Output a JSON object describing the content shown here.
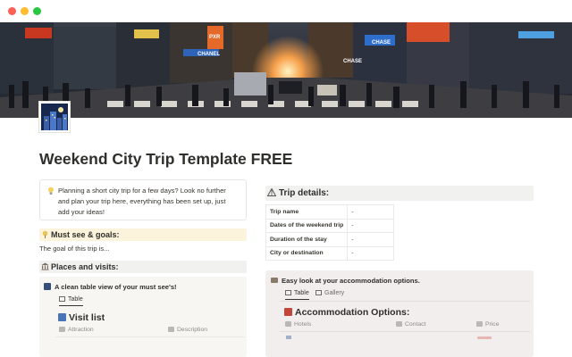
{
  "window": {
    "controls": [
      "close",
      "minimize",
      "zoom"
    ]
  },
  "cover": {
    "image": "city-street-crosswalk-photo",
    "signs": [
      "CHASE",
      "CHASE",
      "CHANEL",
      "PXR"
    ]
  },
  "page": {
    "icon": "city-night-icon",
    "title": "Weekend City Trip Template FREE"
  },
  "callout": {
    "icon": "lightbulb-icon",
    "text": "Planning a short city trip for a few days? Look no further and plan your trip here, everything has been set up, just add your ideas!"
  },
  "must_see": {
    "icon": "pushpin-icon",
    "heading": "Must see & goals:",
    "goal_text": "The goal of this trip is..."
  },
  "places": {
    "icon": "classical-building-icon",
    "heading": "Places and visits:",
    "caption": "A clean table view of your must see's!",
    "caption_icon": "night-city-icon",
    "view_tab": "Table",
    "db_icon": "cityscape-icon",
    "db_title": "Visit list",
    "columns": [
      "Attraction",
      "Description"
    ]
  },
  "trip_details": {
    "icon": "camping-icon",
    "heading": "Trip details:",
    "rows": [
      {
        "label": "Trip name",
        "value": "-"
      },
      {
        "label": "Dates of the weekend trip",
        "value": "-"
      },
      {
        "label": "Duration of the stay",
        "value": "-"
      },
      {
        "label": "City or destination",
        "value": "-"
      }
    ]
  },
  "accommodation": {
    "caption_icon": "bed-icon",
    "caption": "Easy look at your accommodation options.",
    "tabs": [
      {
        "label": "Table",
        "active": true
      },
      {
        "label": "Gallery",
        "active": false
      }
    ],
    "db_icon": "hotel-icon",
    "db_title": "Accommodation Options:",
    "columns": [
      "Hotels",
      "Contact",
      "Price"
    ]
  },
  "colors": {
    "must_see_bg": "#fbf3db",
    "section_bg": "#f1f1ef",
    "places_box_bg": "#f7f6f3",
    "accommodation_bg": "#f3eeee",
    "text": "#37352f"
  }
}
